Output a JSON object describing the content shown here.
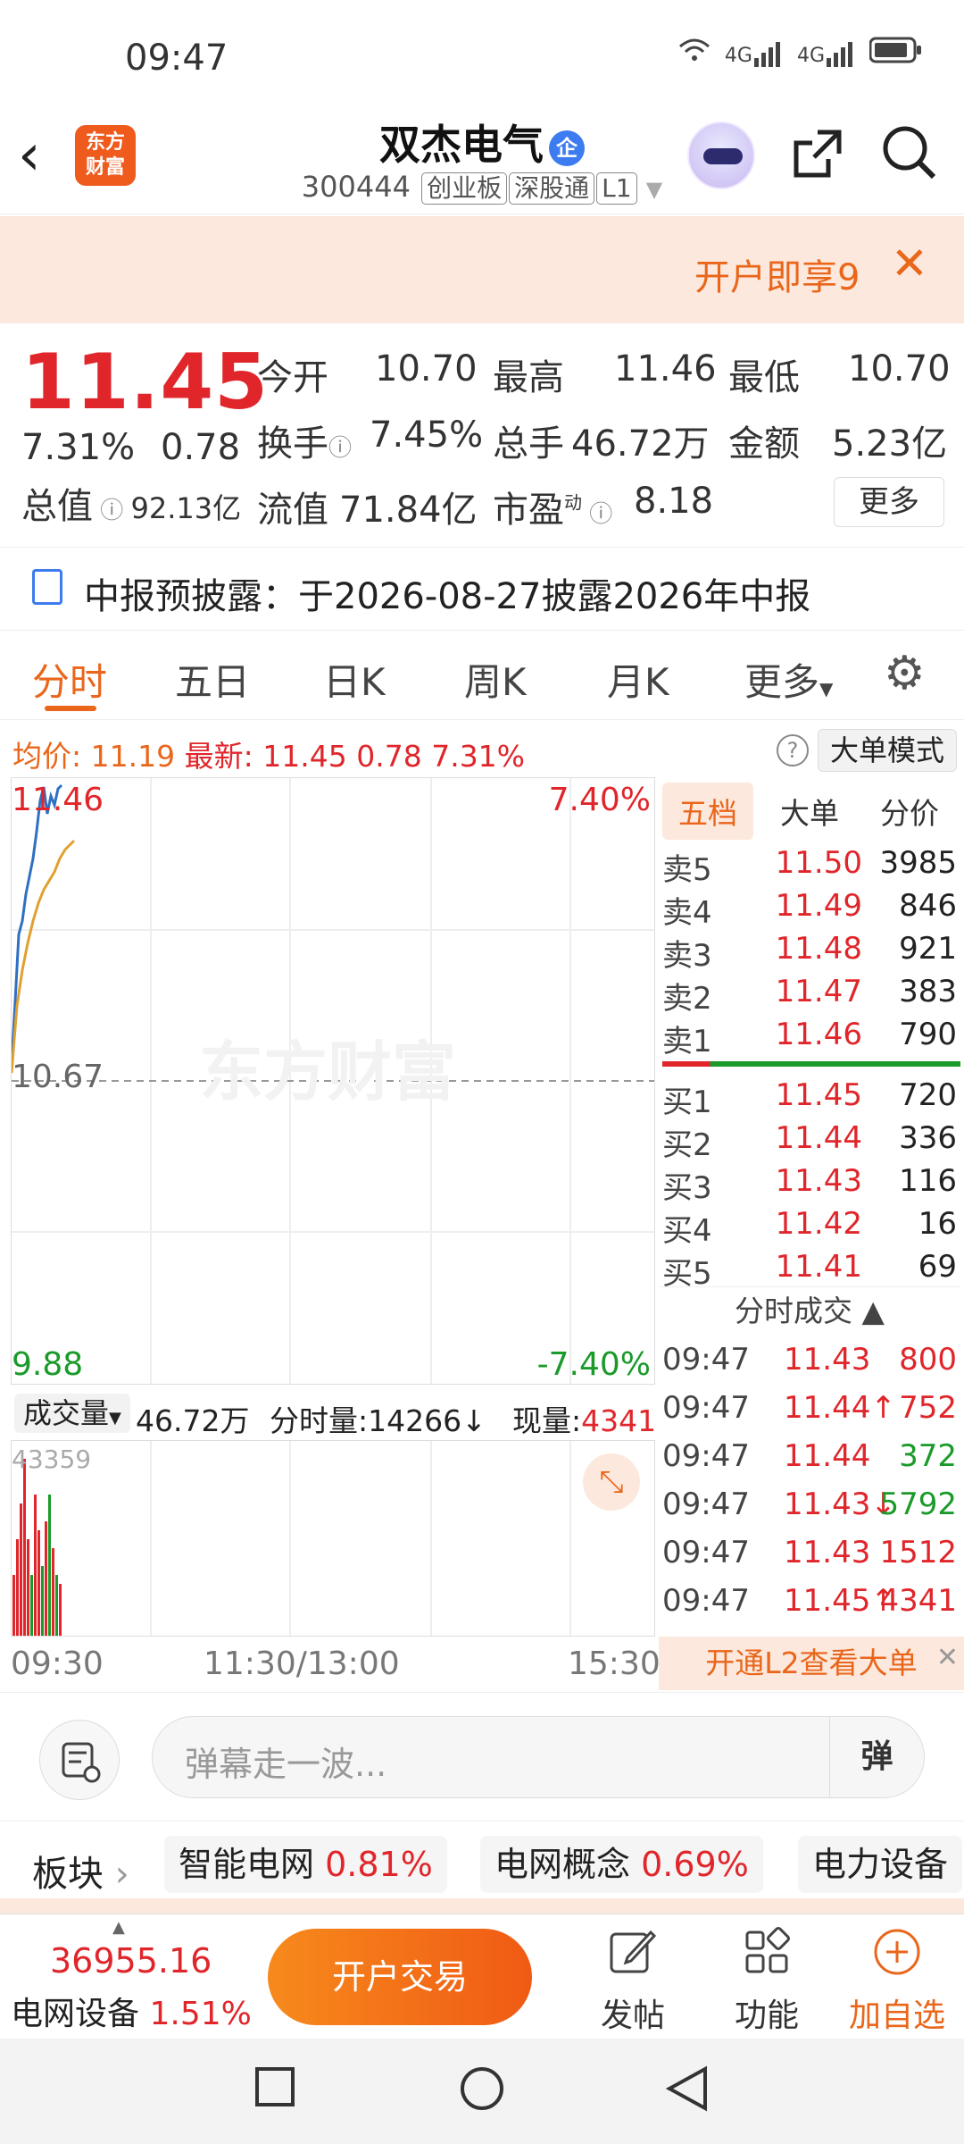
{
  "status_bar": {
    "time": "09:47",
    "net1": "4G",
    "net2": "4G"
  },
  "header": {
    "logo_text_1": "东方",
    "logo_text_2": "财富",
    "stock_name": "双杰电气",
    "badge": "企",
    "code": "300444",
    "tags": [
      "创业板",
      "深股通",
      "L1"
    ]
  },
  "banner": {
    "text": "开户即享9"
  },
  "quote": {
    "price": "11.45",
    "change_pct": "7.31%",
    "change": "0.78",
    "open_label": "今开",
    "open": "10.70",
    "high_label": "最高",
    "high": "11.46",
    "low_label": "最低",
    "low": "10.70",
    "turnover_label": "换手",
    "turnover": "7.45%",
    "volume_label": "总手",
    "volume": "46.72万",
    "amount_label": "金额",
    "amount": "5.23亿",
    "mcap_label": "总值",
    "mcap": "92.13亿",
    "float_label": "流值",
    "float_cap": "71.84亿",
    "pe_label": "市盈",
    "pe_sup": "动",
    "pe": "8.18",
    "more": "更多"
  },
  "notice": {
    "text": "中报预披露：于2026-08-27披露2026年中报"
  },
  "tabs": [
    "分时",
    "五日",
    "日K",
    "周K",
    "月K",
    "更多"
  ],
  "avgline": {
    "avg_label": "均价:",
    "avg": "11.19",
    "last_label": "最新:",
    "last": "11.45",
    "chg": "0.78",
    "pct": "7.31%",
    "help": "?",
    "big_mode": "大单模式"
  },
  "chart_labels": {
    "high": "11.46",
    "high_pct": "7.40%",
    "mid": "10.67",
    "low": "9.88",
    "low_pct": "-7.40%",
    "watermark": "东方财富"
  },
  "volume_bar": {
    "label": "成交量",
    "total": "46.72万",
    "minute_label": "分时量:",
    "minute": "14266↓",
    "now_label": "现量:",
    "now": "4341",
    "max": "43359"
  },
  "time_axis": [
    "09:30",
    "11:30/13:00",
    "15:30"
  ],
  "order_book": {
    "tabs": [
      "五档",
      "大单",
      "分价"
    ],
    "asks": [
      {
        "label": "卖5",
        "price": "11.50",
        "vol": "3985"
      },
      {
        "label": "卖4",
        "price": "11.49",
        "vol": "846"
      },
      {
        "label": "卖3",
        "price": "11.48",
        "vol": "921"
      },
      {
        "label": "卖2",
        "price": "11.47",
        "vol": "383"
      },
      {
        "label": "卖1",
        "price": "11.46",
        "vol": "790"
      }
    ],
    "bids": [
      {
        "label": "买1",
        "price": "11.45",
        "vol": "720"
      },
      {
        "label": "买2",
        "price": "11.44",
        "vol": "336"
      },
      {
        "label": "买3",
        "price": "11.43",
        "vol": "116"
      },
      {
        "label": "买4",
        "price": "11.42",
        "vol": "16"
      },
      {
        "label": "买5",
        "price": "11.41",
        "vol": "69"
      }
    ],
    "ticks_title": "分时成交",
    "ticks": [
      {
        "time": "09:47",
        "price": "11.43",
        "vol": "800",
        "color": "#e0262b"
      },
      {
        "time": "09:47",
        "price": "11.44↑",
        "vol": "752",
        "color": "#e0262b"
      },
      {
        "time": "09:47",
        "price": "11.44",
        "vol": "372",
        "color": "#1a9a2a"
      },
      {
        "time": "09:47",
        "price": "11.43↓",
        "vol": "5792",
        "color": "#1a9a2a"
      },
      {
        "time": "09:47",
        "price": "11.43",
        "vol": "1512",
        "color": "#e0262b"
      },
      {
        "time": "09:47",
        "price": "11.45↑",
        "vol": "4341",
        "color": "#e0262b"
      }
    ],
    "l2_promo": "开通L2查看大单"
  },
  "danmu": {
    "placeholder": "弹幕走一波...",
    "button": "弹"
  },
  "sectors": {
    "label": "板块",
    "items": [
      {
        "name": "智能电网",
        "pct": "0.81%"
      },
      {
        "name": "电网概念",
        "pct": "0.69%"
      },
      {
        "name": "电力设备",
        "pct": ""
      }
    ]
  },
  "bottom_bar": {
    "index_value": "36955.16",
    "index_name": "电网设备",
    "index_pct": "1.51%",
    "trade": "开户交易",
    "post": "发帖",
    "func": "功能",
    "add": "加自选"
  },
  "colors": {
    "up": "#e0262b",
    "down": "#1a9a2a",
    "accent": "#e9661b",
    "price_line": "#2f6fc4",
    "avg_line": "#e0a030"
  }
}
